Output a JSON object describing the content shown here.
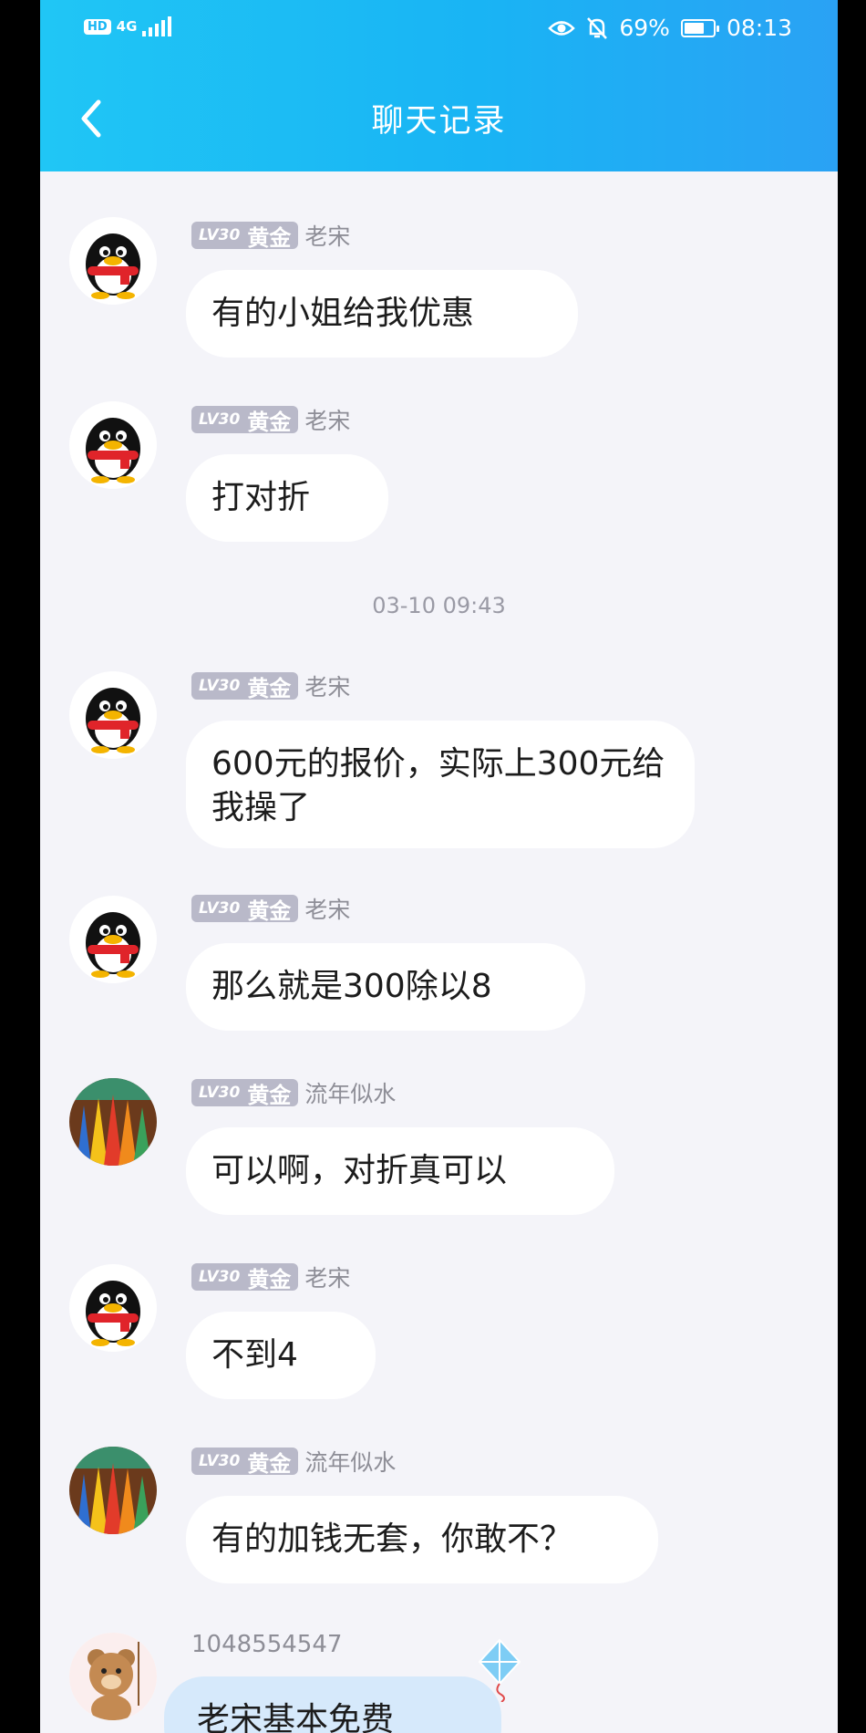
{
  "status_bar": {
    "hd": "HD",
    "network": "4G",
    "battery_percent_label": "69%",
    "battery_level": 0.69,
    "time": "08:13",
    "icons": [
      "eye-icon",
      "mute-bell-icon",
      "battery-icon"
    ]
  },
  "header": {
    "title": "聊天记录",
    "back_icon": "chevron-left-icon"
  },
  "colors": {
    "header_start": "#20c6f5",
    "header_end": "#2aa2f4",
    "badge_bg": "#b9b9c9",
    "background": "#f4f4f9"
  },
  "messages": [
    {
      "level": "LV30",
      "rank": "黄金",
      "sender": "老宋",
      "avatar": "penguin-avatar",
      "text": "有的小姐给我优惠"
    },
    {
      "level": "LV30",
      "rank": "黄金",
      "sender": "老宋",
      "avatar": "penguin-avatar",
      "text": "打对折"
    },
    {
      "level": "LV30",
      "rank": "黄金",
      "sender": "老宋",
      "avatar": "penguin-avatar",
      "text": "600元的报价，实际上300元给我操了"
    },
    {
      "level": "LV30",
      "rank": "黄金",
      "sender": "老宋",
      "avatar": "penguin-avatar",
      "text": "那么就是300除以8"
    },
    {
      "level": "LV30",
      "rank": "黄金",
      "sender": "流年似水",
      "avatar": "pencils-avatar",
      "text": "可以啊，对折真可以"
    },
    {
      "level": "LV30",
      "rank": "黄金",
      "sender": "老宋",
      "avatar": "penguin-avatar",
      "text": "不到4"
    },
    {
      "level": "LV30",
      "rank": "黄金",
      "sender": "流年似水",
      "avatar": "pencils-avatar",
      "text": "有的加钱无套，你敢不？"
    }
  ],
  "timestamp": "03-10 09:43",
  "last_message": {
    "sender_id": "1048554547",
    "avatar": "bear-avatar",
    "text": "老宋基本免费"
  }
}
